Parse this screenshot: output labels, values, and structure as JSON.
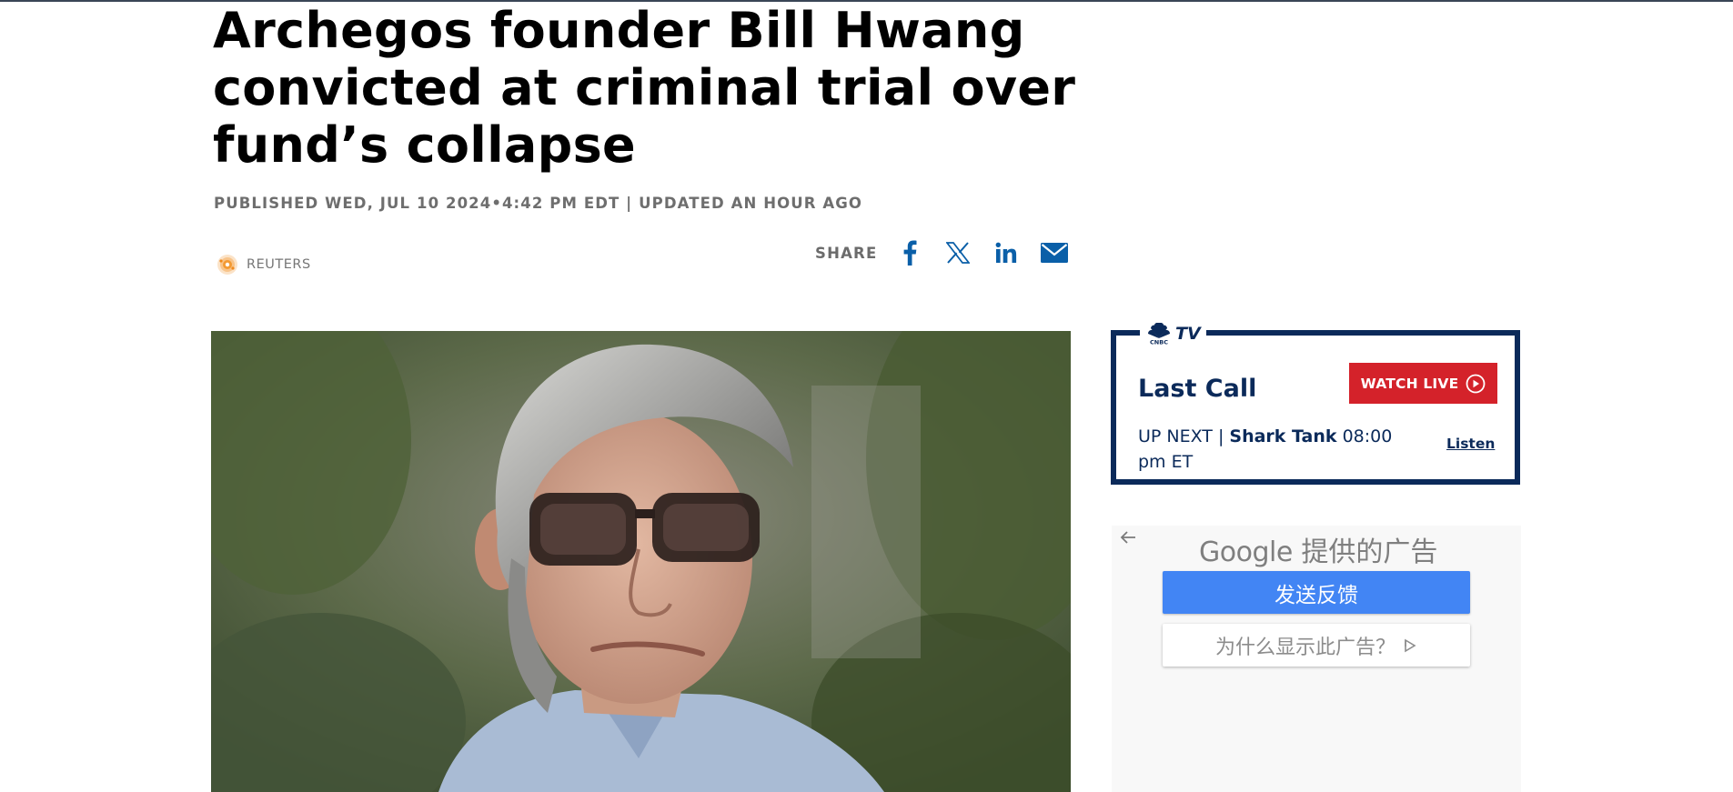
{
  "article": {
    "headline": "Archegos founder Bill Hwang convicted at criminal trial over fund’s collapse",
    "published": "PUBLISHED WED, JUL 10 2024•4:42 PM EDT | UPDATED AN HOUR AGO",
    "source": "REUTERS",
    "share_label": "SHARE",
    "share_icons": [
      "facebook-icon",
      "x-icon",
      "linkedin-icon",
      "email-icon"
    ],
    "hero_image": "photo of Bill Hwang"
  },
  "tv": {
    "logo_text": "TV",
    "show": "Last Call",
    "watch_label": "WATCH LIVE",
    "upnext_prefix": "UP NEXT | ",
    "upnext_show": "Shark Tank",
    "upnext_time": " 08:00 pm ET",
    "listen": "Listen"
  },
  "ad": {
    "brand": "Google",
    "provided": "提供的广告",
    "feedback": "发送反馈",
    "why": "为什么显示此广告？"
  },
  "colors": {
    "navy": "#0b2a5a",
    "red": "#d4222a",
    "google_blue": "#4285f4",
    "share_blue": "#0a5fa8"
  }
}
